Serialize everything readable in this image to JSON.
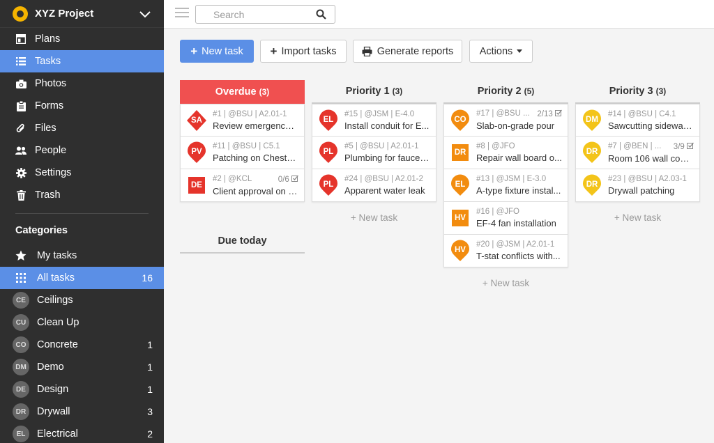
{
  "project": {
    "name": "XYZ Project"
  },
  "nav": [
    {
      "label": "Plans",
      "icon": "plans-icon"
    },
    {
      "label": "Tasks",
      "icon": "list-icon",
      "active": true
    },
    {
      "label": "Photos",
      "icon": "camera-icon"
    },
    {
      "label": "Forms",
      "icon": "clipboard-icon"
    },
    {
      "label": "Files",
      "icon": "paperclip-icon"
    },
    {
      "label": "People",
      "icon": "people-icon"
    },
    {
      "label": "Settings",
      "icon": "gear-icon"
    },
    {
      "label": "Trash",
      "icon": "trash-icon"
    }
  ],
  "categories": {
    "title": "Categories",
    "my_tasks": {
      "label": "My tasks"
    },
    "all_tasks": {
      "label": "All tasks",
      "count": "16"
    },
    "items": [
      {
        "abbr": "CE",
        "label": "Ceilings",
        "count": ""
      },
      {
        "abbr": "CU",
        "label": "Clean Up",
        "count": ""
      },
      {
        "abbr": "CO",
        "label": "Concrete",
        "count": "1"
      },
      {
        "abbr": "DM",
        "label": "Demo",
        "count": "1"
      },
      {
        "abbr": "DE",
        "label": "Design",
        "count": "1"
      },
      {
        "abbr": "DR",
        "label": "Drywall",
        "count": "3"
      },
      {
        "abbr": "EL",
        "label": "Electrical",
        "count": "2"
      }
    ]
  },
  "search": {
    "placeholder": "Search"
  },
  "toolbar": {
    "new_task": "New task",
    "import_tasks": "Import tasks",
    "generate_reports": "Generate reports",
    "actions": "Actions"
  },
  "colors": {
    "accent": "#5b8fe6",
    "overdue": "#f05050",
    "red": "#e5342b",
    "orange": "#f28c0f",
    "yellow": "#f3c419"
  },
  "columns": [
    {
      "title": "Overdue",
      "count": "(3)",
      "cards": [
        {
          "abbr": "SA",
          "shape": "diamond",
          "color": "#e5342b",
          "ref": "#1 | @BSU | A2.01-1",
          "progress": "",
          "title": "Review emergency ..."
        },
        {
          "abbr": "PV",
          "shape": "pin",
          "color": "#e5342b",
          "ref": "#11 | @BSU | C5.1",
          "progress": "",
          "title": "Patching on Chestn..."
        },
        {
          "abbr": "DE",
          "shape": "square",
          "color": "#e5342b",
          "ref": "#2 | @KCL",
          "progress": "0/6",
          "title": "Client approval on c..."
        }
      ]
    },
    {
      "title": "Priority 1",
      "count": "(3)",
      "cards": [
        {
          "abbr": "EL",
          "shape": "pin",
          "color": "#e5342b",
          "ref": "#15 | @JSM | E-4.0",
          "progress": "",
          "title": "Install conduit for E..."
        },
        {
          "abbr": "PL",
          "shape": "pin",
          "color": "#e5342b",
          "ref": "#5 | @BSU | A2.01-1",
          "progress": "",
          "title": "Plumbing for faucet ..."
        },
        {
          "abbr": "PL",
          "shape": "pin",
          "color": "#e5342b",
          "ref": "#24 | @BSU | A2.01-2",
          "progress": "",
          "title": "Apparent water leak"
        }
      ],
      "new_task": "+ New task"
    },
    {
      "title": "Priority 2",
      "count": "(5)",
      "cards": [
        {
          "abbr": "CO",
          "shape": "pin",
          "color": "#f28c0f",
          "ref": "#17 | @BSU ...",
          "progress": "2/13",
          "title": "Slab-on-grade pour"
        },
        {
          "abbr": "DR",
          "shape": "square",
          "color": "#f28c0f",
          "ref": "#8 | @JFO",
          "progress": "",
          "title": "Repair wall board o..."
        },
        {
          "abbr": "EL",
          "shape": "pin",
          "color": "#f28c0f",
          "ref": "#13 | @JSM | E-3.0",
          "progress": "",
          "title": "A-type fixture instal..."
        },
        {
          "abbr": "HV",
          "shape": "square",
          "color": "#f28c0f",
          "ref": "#16 | @JFO",
          "progress": "",
          "title": "EF-4 fan installation"
        },
        {
          "abbr": "HV",
          "shape": "pin",
          "color": "#f28c0f",
          "ref": "#20 | @JSM | A2.01-1",
          "progress": "",
          "title": "T-stat conflicts with..."
        }
      ],
      "new_task": "+ New task"
    },
    {
      "title": "Priority 3",
      "count": "(3)",
      "cards": [
        {
          "abbr": "DM",
          "shape": "pin",
          "color": "#f3c419",
          "ref": "#14 | @BSU | C4.1",
          "progress": "",
          "title": "Sawcutting sidewalk..."
        },
        {
          "abbr": "DR",
          "shape": "pin",
          "color": "#f3c419",
          "ref": "#7 | @BEN | ...",
          "progress": "3/9",
          "title": "Room 106 wall com..."
        },
        {
          "abbr": "DR",
          "shape": "pin",
          "color": "#f3c419",
          "ref": "#23 | @BSU | A2.03-1",
          "progress": "",
          "title": "Drywall patching"
        }
      ],
      "new_task": "+ New task"
    }
  ],
  "due_today": {
    "title": "Due today"
  }
}
